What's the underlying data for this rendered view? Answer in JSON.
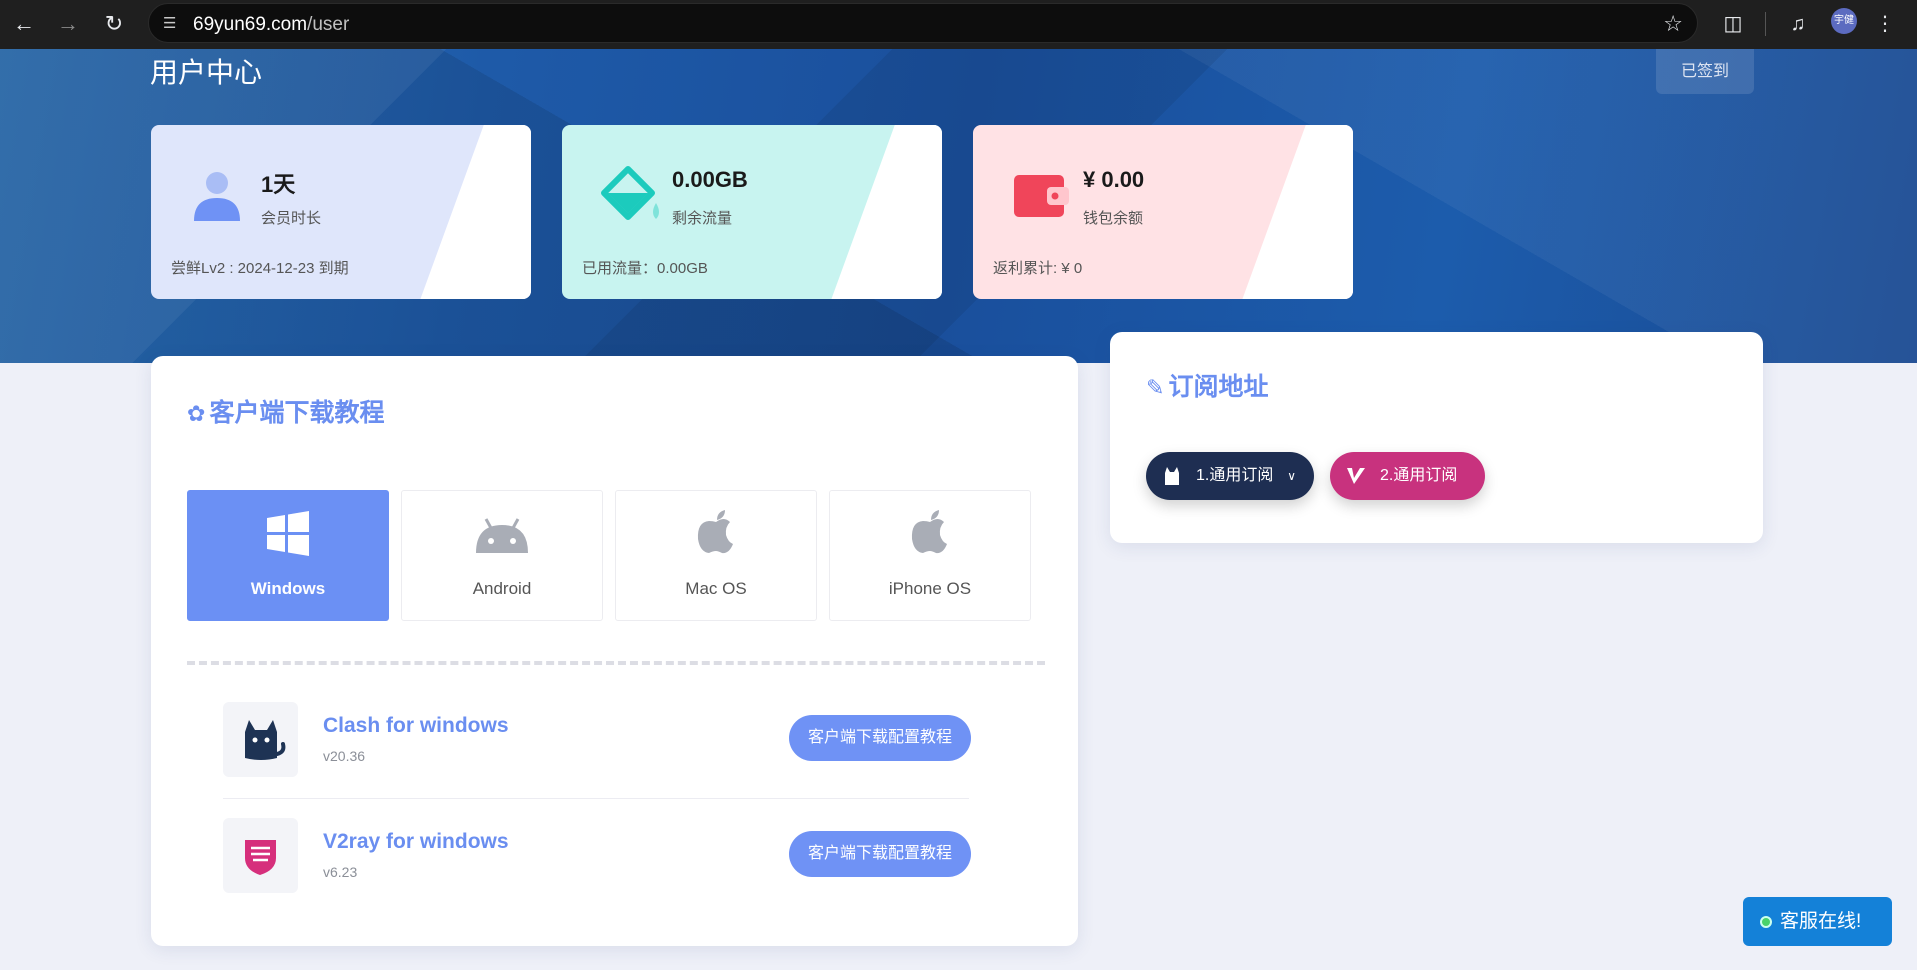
{
  "browser": {
    "url_domain": "69yun69.com",
    "url_path": "/user",
    "profile_initials": "宇健"
  },
  "header": {
    "title": "用户中心",
    "checkin_label": "已签到"
  },
  "stats": [
    {
      "value": "1天",
      "label": "会员时长",
      "foot": "尝鲜Lv2 : 2024-12-23 到期",
      "icon": "user-icon",
      "bg": "#dfe6fb"
    },
    {
      "value": "0.00GB",
      "label": "剩余流量",
      "foot": "已用流量：0.00GB",
      "icon": "bucket-icon",
      "bg": "#c8f4f0"
    },
    {
      "value": "¥ 0.00",
      "label": "钱包余额",
      "foot": "返利累计: ¥ 0",
      "icon": "wallet-icon",
      "bg": "#ffe2e5"
    }
  ],
  "download": {
    "title": "客户端下载教程",
    "os_tabs": [
      {
        "label": "Windows",
        "icon": "windows-icon",
        "active": true
      },
      {
        "label": "Android",
        "icon": "android-icon",
        "active": false
      },
      {
        "label": "Mac OS",
        "icon": "apple-icon",
        "active": false
      },
      {
        "label": "iPhone OS",
        "icon": "apple-icon",
        "active": false
      }
    ],
    "clients": [
      {
        "name": "Clash for windows",
        "version": "v20.36",
        "button": "客户端下载配置教程",
        "icon": "clash-cat-icon"
      },
      {
        "name": "V2ray for windows",
        "version": "v6.23",
        "button": "客户端下载配置教程",
        "icon": "v2ray-icon"
      }
    ]
  },
  "subscription": {
    "title": "订阅地址",
    "buttons": [
      {
        "label": "1.通用订阅",
        "icon": "clash-cat-icon",
        "color": "#1e2e52"
      },
      {
        "label": "2.通用订阅",
        "icon": "v2ray-v-icon",
        "color": "#c8327e"
      }
    ]
  },
  "support": {
    "label": "客服在线!"
  },
  "colors": {
    "accent": "#6b90f4",
    "hero": "#1e5aa8",
    "support": "#1481d8"
  }
}
